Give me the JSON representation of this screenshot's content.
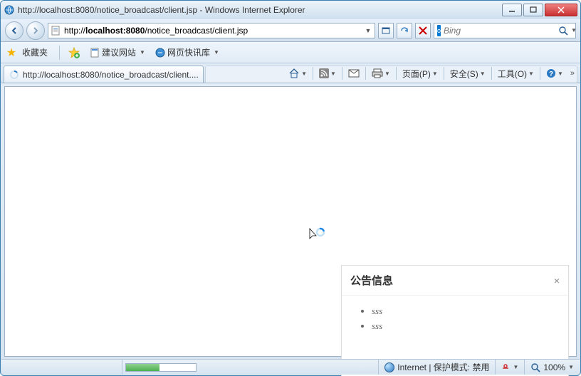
{
  "window_title": "http://localhost:8080/notice_broadcast/client.jsp - Windows Internet Explorer",
  "address": {
    "prefix": "http://",
    "host": "localhost:8080",
    "path": "/notice_broadcast/client.jsp"
  },
  "search": {
    "placeholder": "Bing"
  },
  "favorites": {
    "label": "收藏夹",
    "items": [
      {
        "label": "建议网站",
        "has_dropdown": true
      },
      {
        "label": "网页快讯库",
        "has_dropdown": true
      }
    ]
  },
  "tab": {
    "title": "http://localhost:8080/notice_broadcast/client...."
  },
  "commandbar": {
    "page": "页面(P)",
    "safety": "安全(S)",
    "tools": "工具(O)"
  },
  "panel": {
    "title": "公告信息",
    "items": [
      "sss",
      "sss"
    ]
  },
  "status": {
    "zone": "Internet | 保护模式: 禁用",
    "zoom": "100%"
  }
}
